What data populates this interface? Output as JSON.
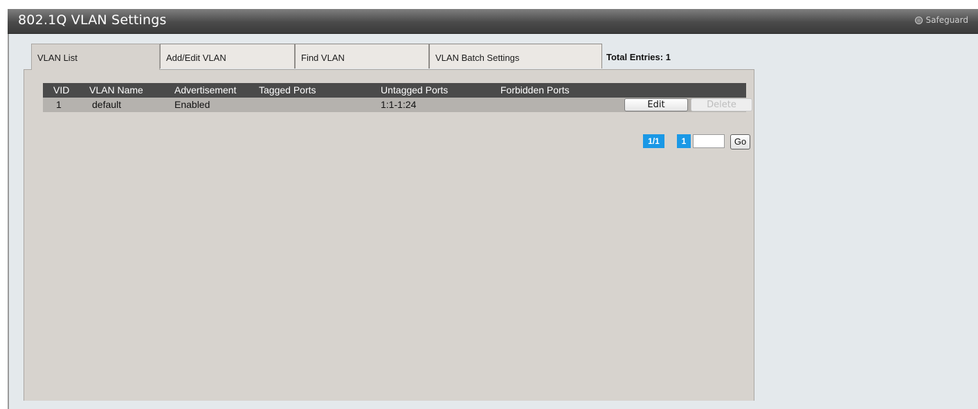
{
  "header": {
    "title": "802.1Q VLAN Settings",
    "safeguard_label": "Safeguard",
    "safeguard_icon": "safeguard-status-icon"
  },
  "tabs": [
    {
      "label": "VLAN List",
      "active": true
    },
    {
      "label": "Add/Edit VLAN",
      "active": false
    },
    {
      "label": "Find VLAN",
      "active": false
    },
    {
      "label": "VLAN Batch Settings",
      "active": false
    }
  ],
  "total_entries": "Total Entries: 1",
  "table": {
    "columns": [
      "VID",
      "VLAN Name",
      "Advertisement",
      "Tagged Ports",
      "Untagged Ports",
      "Forbidden Ports"
    ],
    "rows": [
      {
        "vid": "1",
        "name": "default",
        "advertisement": "Enabled",
        "tagged": "",
        "untagged": "1:1-1:24",
        "forbidden": "",
        "edit_label": "Edit",
        "delete_label": "Delete"
      }
    ]
  },
  "pagination": {
    "page_info": "1/1",
    "current_page": "1",
    "goto_value": "",
    "go_label": "Go"
  },
  "colors": {
    "title_bar": "#4a4a4a",
    "panel": "#d7d3ce",
    "header_row": "#4a4a4a",
    "pager_accent": "#1a98e6"
  }
}
